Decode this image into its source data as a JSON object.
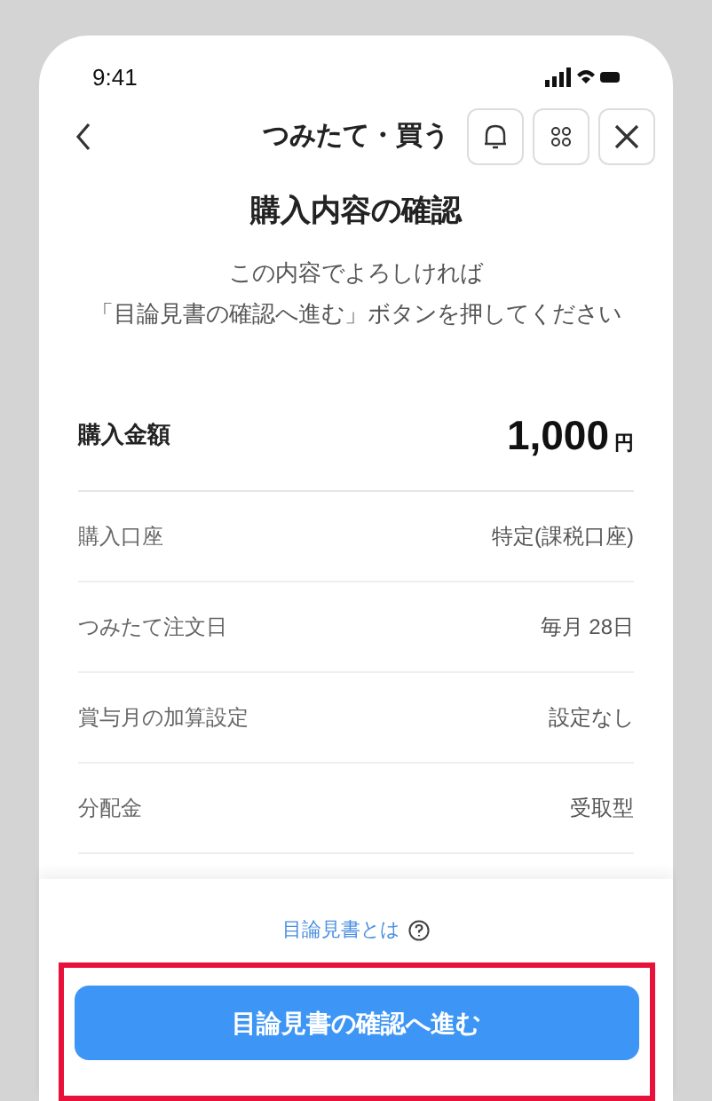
{
  "status_bar": {
    "time": "9:41"
  },
  "header": {
    "title": "つみたて・買う"
  },
  "heading": "購入内容の確認",
  "instructions": [
    "この内容でよろしければ",
    "「目論見書の確認へ進む」ボタンを押してください"
  ],
  "amount": {
    "label": "購入金額",
    "value": "1,000",
    "unit": "円"
  },
  "rows": [
    {
      "label": "購入口座",
      "value": "特定(課税口座)"
    },
    {
      "label": "つみたて注文日",
      "value": "毎月 28日"
    },
    {
      "label": "賞与月の加算設定",
      "value": "設定なし"
    },
    {
      "label": "分配金",
      "value": "受取型"
    }
  ],
  "footer": {
    "link": "目論見書とは",
    "button": "目論見書の確認へ進む",
    "highlighted": true
  }
}
